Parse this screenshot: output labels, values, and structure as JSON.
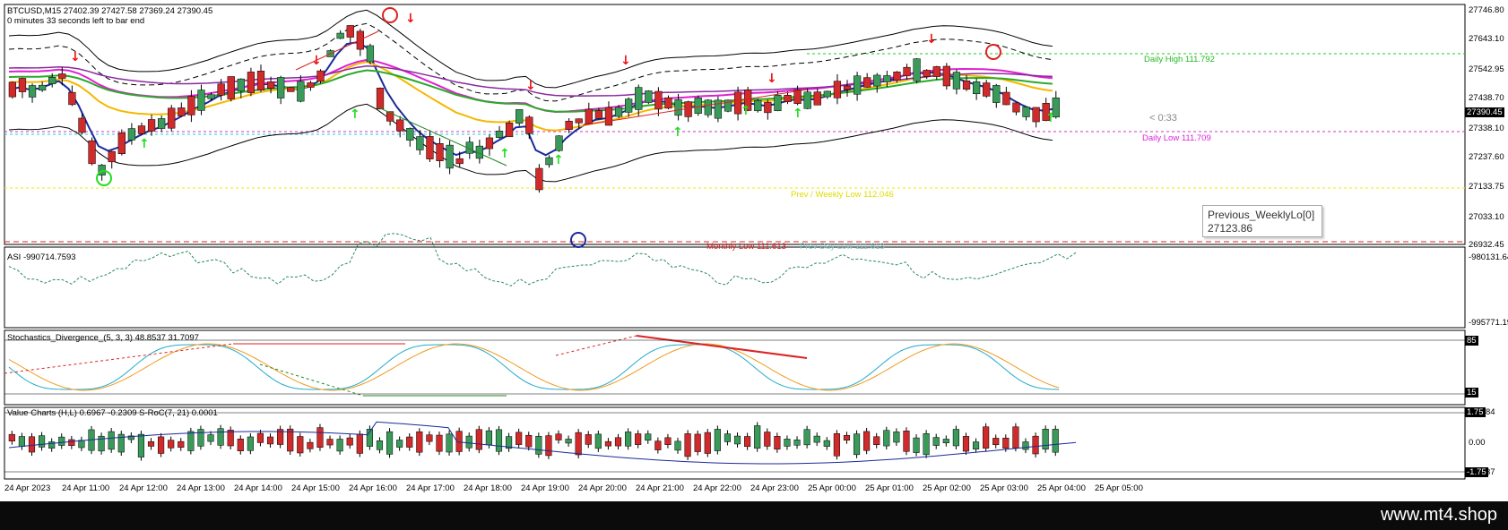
{
  "main": {
    "header_line1": "BTCUSD,M15  27402.39 27427.58 27369.24 27390.45",
    "header_line2": "0 minutes 33 seconds left to bar end",
    "price_axis": [
      "27746.80",
      "27643.10",
      "27542.95",
      "27438.70",
      "27338.10",
      "27237.60",
      "27133.75",
      "27033.10",
      "26932.45"
    ],
    "current_price": "27390.45",
    "countdown": "< 0:33",
    "daily_high": "Daily High 111.792",
    "daily_low": "Daily Low 111.709",
    "prev_weekly_low": "Prev / Weekly Low 112.046",
    "monthly_low": "Monthly Low 111.613",
    "prev_day_low": "Prev Day Low 111.613",
    "tooltip_title": "Previous_WeeklyLo[0]",
    "tooltip_value": "27123.86"
  },
  "asi": {
    "header": "ASI -990714.7593",
    "axis_top": "-980131.64",
    "axis_bottom": "-995771.19"
  },
  "stoch": {
    "header": "Stochastics_Divergence_(5, 3, 3) 48.8537 31.7097",
    "axis_top": "85",
    "axis_bottom": "15"
  },
  "value_charts": {
    "header": "Value Charts (H,L) 0.6967 -0.2309  S-RoC(7, 21) 0.0001",
    "axis_top": "1.75",
    "axis_mid": "0.00",
    "axis_bottom": "-1.75",
    "axis_top_suffix": "84",
    "axis_bottom_suffix": "37"
  },
  "time_axis": [
    "24 Apr 2023",
    "24 Apr 11:00",
    "24 Apr 12:00",
    "24 Apr 13:00",
    "24 Apr 14:00",
    "24 Apr 15:00",
    "24 Apr 16:00",
    "24 Apr 17:00",
    "24 Apr 18:00",
    "24 Apr 19:00",
    "24 Apr 20:00",
    "24 Apr 21:00",
    "24 Apr 22:00",
    "24 Apr 23:00",
    "25 Apr 00:00",
    "25 Apr 01:00",
    "25 Apr 02:00",
    "25 Apr 03:00",
    "25 Apr 04:00",
    "25 Apr 05:00"
  ],
  "watermark": "www.mt4.shop",
  "colors": {
    "bull": "#3a9a5a",
    "bear": "#d02a2a",
    "ma_blue": "#1a2a9a",
    "ma_yellow": "#f5b800",
    "ma_magenta": "#e020d0",
    "ma_green": "#2aaa2a",
    "ma_purple": "#8a2aa0",
    "arrow_up": "#22dd22",
    "arrow_down": "#ee1111"
  }
}
